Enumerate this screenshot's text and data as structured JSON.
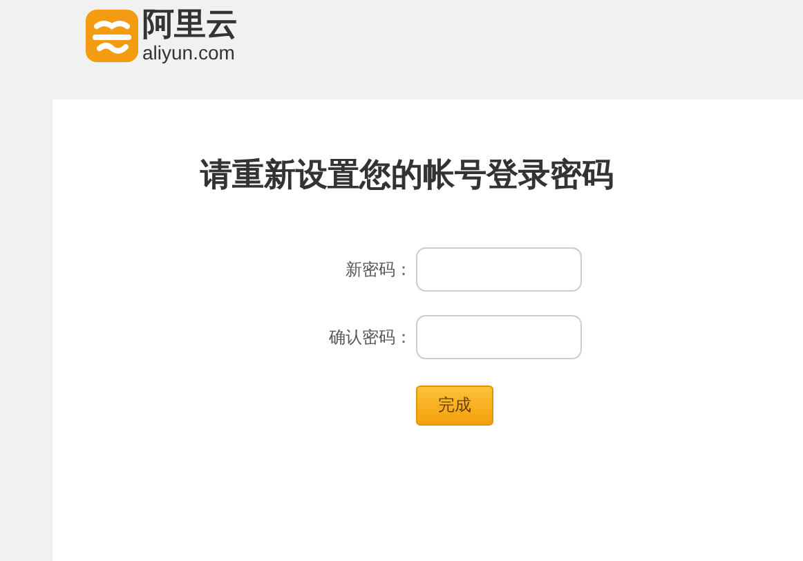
{
  "logo": {
    "name": "阿里云",
    "domain": "aliyun.com"
  },
  "title": "请重新设置您的帐号登录密码",
  "fields": [
    {
      "label": "新密码："
    },
    {
      "label": "确认密码："
    }
  ],
  "submit": "完成"
}
